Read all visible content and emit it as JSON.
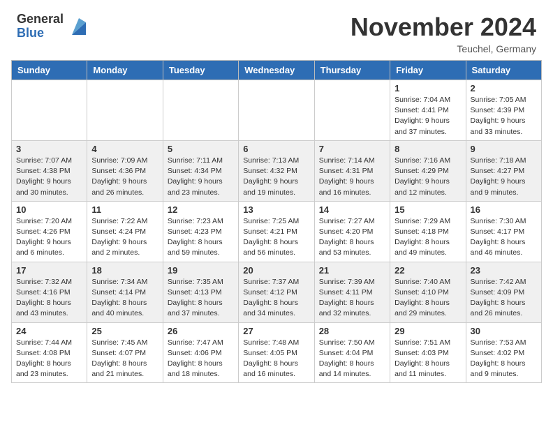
{
  "header": {
    "logo_general": "General",
    "logo_blue": "Blue",
    "title": "November 2024",
    "location": "Teuchel, Germany"
  },
  "days_of_week": [
    "Sunday",
    "Monday",
    "Tuesday",
    "Wednesday",
    "Thursday",
    "Friday",
    "Saturday"
  ],
  "weeks": [
    [
      {
        "day": "",
        "info": ""
      },
      {
        "day": "",
        "info": ""
      },
      {
        "day": "",
        "info": ""
      },
      {
        "day": "",
        "info": ""
      },
      {
        "day": "",
        "info": ""
      },
      {
        "day": "1",
        "info": "Sunrise: 7:04 AM\nSunset: 4:41 PM\nDaylight: 9 hours\nand 37 minutes."
      },
      {
        "day": "2",
        "info": "Sunrise: 7:05 AM\nSunset: 4:39 PM\nDaylight: 9 hours\nand 33 minutes."
      }
    ],
    [
      {
        "day": "3",
        "info": "Sunrise: 7:07 AM\nSunset: 4:38 PM\nDaylight: 9 hours\nand 30 minutes."
      },
      {
        "day": "4",
        "info": "Sunrise: 7:09 AM\nSunset: 4:36 PM\nDaylight: 9 hours\nand 26 minutes."
      },
      {
        "day": "5",
        "info": "Sunrise: 7:11 AM\nSunset: 4:34 PM\nDaylight: 9 hours\nand 23 minutes."
      },
      {
        "day": "6",
        "info": "Sunrise: 7:13 AM\nSunset: 4:32 PM\nDaylight: 9 hours\nand 19 minutes."
      },
      {
        "day": "7",
        "info": "Sunrise: 7:14 AM\nSunset: 4:31 PM\nDaylight: 9 hours\nand 16 minutes."
      },
      {
        "day": "8",
        "info": "Sunrise: 7:16 AM\nSunset: 4:29 PM\nDaylight: 9 hours\nand 12 minutes."
      },
      {
        "day": "9",
        "info": "Sunrise: 7:18 AM\nSunset: 4:27 PM\nDaylight: 9 hours\nand 9 minutes."
      }
    ],
    [
      {
        "day": "10",
        "info": "Sunrise: 7:20 AM\nSunset: 4:26 PM\nDaylight: 9 hours\nand 6 minutes."
      },
      {
        "day": "11",
        "info": "Sunrise: 7:22 AM\nSunset: 4:24 PM\nDaylight: 9 hours\nand 2 minutes."
      },
      {
        "day": "12",
        "info": "Sunrise: 7:23 AM\nSunset: 4:23 PM\nDaylight: 8 hours\nand 59 minutes."
      },
      {
        "day": "13",
        "info": "Sunrise: 7:25 AM\nSunset: 4:21 PM\nDaylight: 8 hours\nand 56 minutes."
      },
      {
        "day": "14",
        "info": "Sunrise: 7:27 AM\nSunset: 4:20 PM\nDaylight: 8 hours\nand 53 minutes."
      },
      {
        "day": "15",
        "info": "Sunrise: 7:29 AM\nSunset: 4:18 PM\nDaylight: 8 hours\nand 49 minutes."
      },
      {
        "day": "16",
        "info": "Sunrise: 7:30 AM\nSunset: 4:17 PM\nDaylight: 8 hours\nand 46 minutes."
      }
    ],
    [
      {
        "day": "17",
        "info": "Sunrise: 7:32 AM\nSunset: 4:16 PM\nDaylight: 8 hours\nand 43 minutes."
      },
      {
        "day": "18",
        "info": "Sunrise: 7:34 AM\nSunset: 4:14 PM\nDaylight: 8 hours\nand 40 minutes."
      },
      {
        "day": "19",
        "info": "Sunrise: 7:35 AM\nSunset: 4:13 PM\nDaylight: 8 hours\nand 37 minutes."
      },
      {
        "day": "20",
        "info": "Sunrise: 7:37 AM\nSunset: 4:12 PM\nDaylight: 8 hours\nand 34 minutes."
      },
      {
        "day": "21",
        "info": "Sunrise: 7:39 AM\nSunset: 4:11 PM\nDaylight: 8 hours\nand 32 minutes."
      },
      {
        "day": "22",
        "info": "Sunrise: 7:40 AM\nSunset: 4:10 PM\nDaylight: 8 hours\nand 29 minutes."
      },
      {
        "day": "23",
        "info": "Sunrise: 7:42 AM\nSunset: 4:09 PM\nDaylight: 8 hours\nand 26 minutes."
      }
    ],
    [
      {
        "day": "24",
        "info": "Sunrise: 7:44 AM\nSunset: 4:08 PM\nDaylight: 8 hours\nand 23 minutes."
      },
      {
        "day": "25",
        "info": "Sunrise: 7:45 AM\nSunset: 4:07 PM\nDaylight: 8 hours\nand 21 minutes."
      },
      {
        "day": "26",
        "info": "Sunrise: 7:47 AM\nSunset: 4:06 PM\nDaylight: 8 hours\nand 18 minutes."
      },
      {
        "day": "27",
        "info": "Sunrise: 7:48 AM\nSunset: 4:05 PM\nDaylight: 8 hours\nand 16 minutes."
      },
      {
        "day": "28",
        "info": "Sunrise: 7:50 AM\nSunset: 4:04 PM\nDaylight: 8 hours\nand 14 minutes."
      },
      {
        "day": "29",
        "info": "Sunrise: 7:51 AM\nSunset: 4:03 PM\nDaylight: 8 hours\nand 11 minutes."
      },
      {
        "day": "30",
        "info": "Sunrise: 7:53 AM\nSunset: 4:02 PM\nDaylight: 8 hours\nand 9 minutes."
      }
    ]
  ],
  "colors": {
    "header_bg": "#2e6db4",
    "alt_row": "#f0f0f0"
  }
}
